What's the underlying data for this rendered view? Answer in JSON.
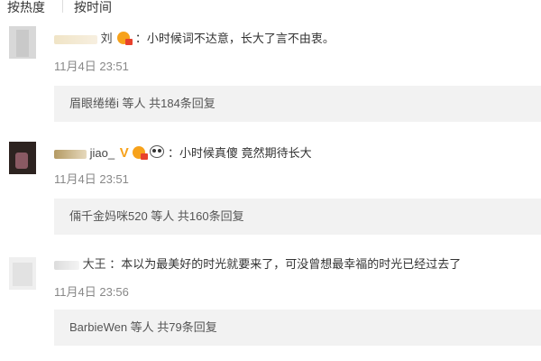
{
  "sort": {
    "hot": "按热度",
    "time": "按时间"
  },
  "comments": [
    {
      "user": "刘",
      "text": "小时候词不达意，长大了言不由衷。",
      "time": "11月4日 23:51",
      "reply": "眉眼绻绻i 等人 共184条回复"
    },
    {
      "user": "jiao_",
      "text": "小时候真傻 竟然期待长大",
      "time": "11月4日 23:51",
      "reply": "倆千金妈咪520 等人 共160条回复"
    },
    {
      "user": "大王",
      "text": "本以为最美好的时光就要来了，可没曾想最幸福的时光已经过去了",
      "time": "11月4日 23:56",
      "reply": "BarbieWen 等人 共79条回复"
    }
  ],
  "colors": {
    "badge_orange": "#f7a21b",
    "badge_red": "#e8412c",
    "reply_bg": "#f2f2f2",
    "time_gray": "#888888"
  }
}
